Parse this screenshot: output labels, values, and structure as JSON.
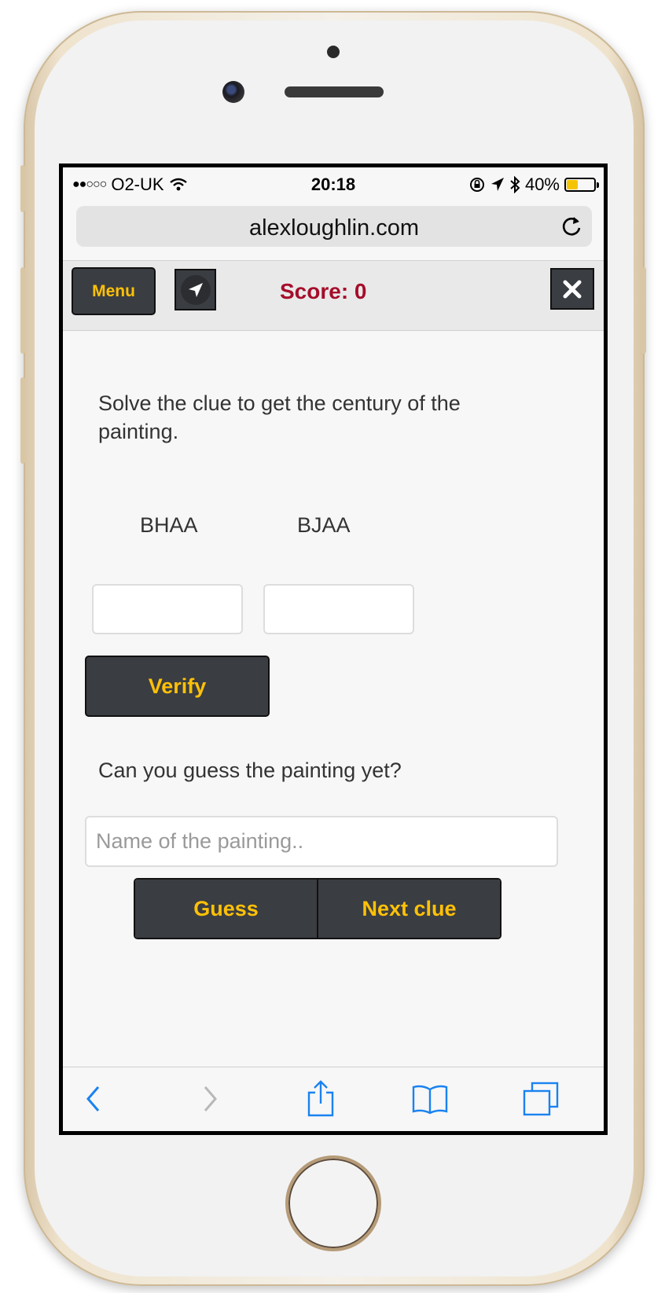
{
  "status_bar": {
    "signal": "●●○○○",
    "carrier": "O2-UK",
    "time": "20:18",
    "battery_percent": "40%",
    "battery_level": 0.4
  },
  "browser": {
    "url": "alexloughlin.com"
  },
  "app_bar": {
    "menu_label": "Menu",
    "score_text": "Score: 0"
  },
  "clue": {
    "instruction": "Solve the clue to get the century of the painting.",
    "codes": [
      "BHAA",
      "BJAA"
    ],
    "verify_label": "Verify"
  },
  "guess": {
    "prompt": "Can you guess the painting yet?",
    "placeholder": "Name of the painting..",
    "guess_label": "Guess",
    "next_label": "Next clue"
  },
  "colors": {
    "accent": "#ffc107",
    "button_bg": "#3a3d42",
    "score": "#a50d2a",
    "ios_blue": "#1a82f0"
  }
}
